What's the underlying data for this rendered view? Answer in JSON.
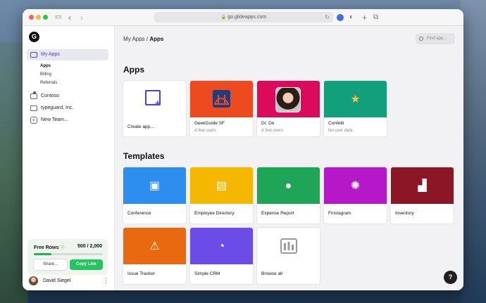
{
  "browser": {
    "url": "go.glideapps.com",
    "back_icon": "chevron-left-icon",
    "forward_icon": "chevron-right-icon"
  },
  "sidebar": {
    "logo_letter": "G",
    "items": [
      {
        "label": "My Apps",
        "active": true
      },
      {
        "label": "Contoso"
      },
      {
        "label": "typeguard, Inc."
      },
      {
        "label": "New Team..."
      }
    ],
    "sub_items": [
      {
        "label": "Apps",
        "active": true
      },
      {
        "label": "Billing"
      },
      {
        "label": "Referrals"
      }
    ],
    "free_rows": {
      "title": "Free Rows",
      "count": "500 / 2,000",
      "progress": 0.25,
      "share_label": "Share...",
      "copy_label": "Copy Link"
    },
    "user": {
      "name": "David Siegel"
    }
  },
  "main": {
    "breadcrumb_parent": "My Apps",
    "breadcrumb_sep": " / ",
    "breadcrumb_current": "Apps",
    "find_placeholder": "Find app...",
    "apps_title": "Apps",
    "templates_title": "Templates",
    "apps": [
      {
        "title": "Create app...",
        "subtitle": "",
        "color": "#ffffff",
        "icon": "create-app-icon"
      },
      {
        "title": "GeekGuide SF",
        "subtitle": "A few users",
        "color": "#ee4a1f",
        "icon": "bridge-icon"
      },
      {
        "title": "Dr. Do",
        "subtitle": "A few users",
        "color": "#dc0a5c",
        "icon": "portrait-photo"
      },
      {
        "title": "Confetti",
        "subtitle": "No user data",
        "color": "#12a07c",
        "icon": "shooting-star-icon"
      }
    ],
    "templates": [
      {
        "title": "Conference",
        "color": "#2d8ef0",
        "icon": "presenter-icon"
      },
      {
        "title": "Employee Directory",
        "color": "#f5b800",
        "icon": "contact-book-icon"
      },
      {
        "title": "Expense Report",
        "color": "#1fa557",
        "icon": "piggy-bank-icon"
      },
      {
        "title": "Finstagram",
        "color": "#b517c9",
        "icon": "camera-aperture-icon"
      },
      {
        "title": "Inventory",
        "color": "#8c1526",
        "icon": "hand-truck-icon"
      },
      {
        "title": "Issue Tracker",
        "color": "#e8690f",
        "icon": "clipboard-warning-icon"
      },
      {
        "title": "Simple CRM",
        "color": "#6c4ce6",
        "icon": "gauge-icon"
      },
      {
        "title": "Browse all",
        "color": "#ffffff",
        "icon": "grid-browse-icon"
      }
    ]
  },
  "help_label": "?"
}
